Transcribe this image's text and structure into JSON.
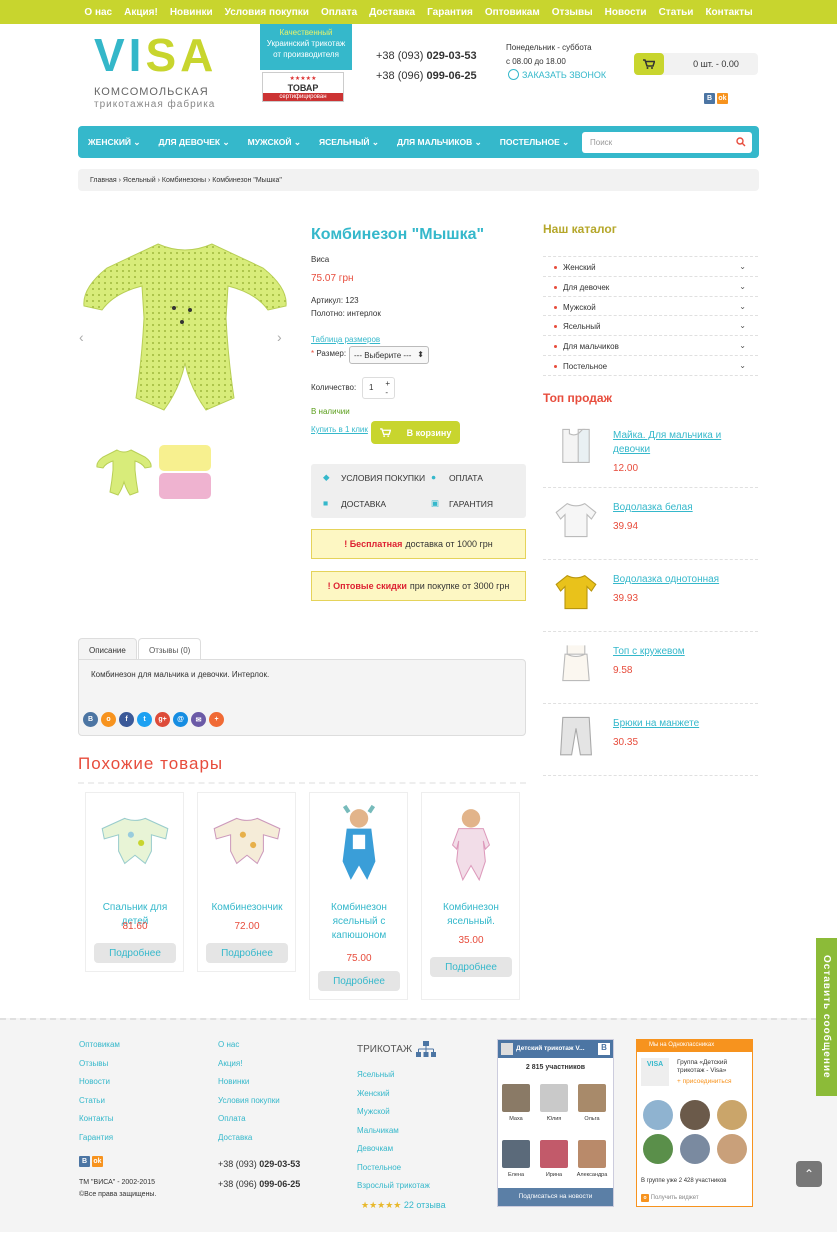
{
  "topnav": [
    "О нас",
    "Акция!",
    "Новинки",
    "Условия покупки",
    "Оплата",
    "Доставка",
    "Гарантия",
    "Оптовикам",
    "Отзывы",
    "Новости",
    "Статьи",
    "Контакты"
  ],
  "logo": {
    "part1": "VI",
    "part2": "SA",
    "sub1": "КОМСОМОЛЬСКАЯ",
    "sub2": "трикотажная фабрика"
  },
  "badge": {
    "line1": "Качественный",
    "line2": "Украинский трикотаж",
    "line3": "от производителя"
  },
  "cert": {
    "title": "ТОВАР",
    "sub": "сертифицирован",
    "stars": "★★★★★"
  },
  "phones": [
    {
      "prefix": "+38 (093) ",
      "number": "029-03-53"
    },
    {
      "prefix": "+38 (096) ",
      "number": "099-06-25"
    }
  ],
  "hours": {
    "days": "Понедельник - суббота",
    "time": "с 08.00 до 18.00"
  },
  "callback": "ЗАКАЗАТЬ ЗВОНОК",
  "cart": {
    "text": "0 шт. - 0.00"
  },
  "social_small": {
    "vk": "В",
    "ok": "ok"
  },
  "nav": [
    "ЖЕНСКИЙ",
    "ДЛЯ ДЕВОЧЕК",
    "МУЖСКОЙ",
    "ЯСЕЛЬНЫЙ",
    "ДЛЯ МАЛЬЧИКОВ",
    "ПОСТЕЛЬНОЕ"
  ],
  "search": {
    "placeholder": "Поиск"
  },
  "breadcrumb": [
    "Главная",
    "Ясельный",
    "Комбинезоны",
    "Комбинезон \"Мышка\""
  ],
  "product": {
    "title": "Комбинезон \"Мышка\"",
    "brand": "Виса",
    "price": "75.07 грн",
    "sku_label": "Артикул:",
    "sku": "123",
    "fabric_label": "Полотно:",
    "fabric": "интерлок",
    "size_table": "Таблица размеров",
    "size_label": "Размер:",
    "size_value": "--- Выберите ---",
    "qty_label": "Количество:",
    "qty": "1",
    "stock": "В наличии",
    "one_click": "Купить в 1 клик",
    "add_to_cart": "В корзину"
  },
  "info_links": [
    "УСЛОВИЯ ПОКУПКИ",
    "ОПЛАТА",
    "ДОСТАВКА",
    "ГАРАНТИЯ"
  ],
  "promos": [
    {
      "bold": "! Бесплатная",
      "text": "доставка от 1000 грн"
    },
    {
      "bold": "! Оптовые скидки",
      "text": "при покупке от 3000 грн"
    }
  ],
  "tabs": [
    "Описание",
    "Отзывы (0)"
  ],
  "description": "Комбинезон для мальчика и девочки. Интерлок.",
  "share_icons": [
    "В",
    "о",
    "f",
    "t",
    "g+",
    "@",
    "✉",
    "+"
  ],
  "sidebar": {
    "catalog_title": "Наш каталог",
    "catalog": [
      "Женский",
      "Для девочек",
      "Мужской",
      "Ясельный",
      "Для мальчиков",
      "Постельное"
    ],
    "top_title": "Топ продаж",
    "top": [
      {
        "name": "Майка. Для мальчика и девочки",
        "price": "12.00"
      },
      {
        "name": "Водолазка белая",
        "price": "39.94"
      },
      {
        "name": "Водолазка однотонная",
        "price": "39.93"
      },
      {
        "name": "Топ с кружевом",
        "price": "9.58"
      },
      {
        "name": "Брюки на манжете",
        "price": "30.35"
      }
    ]
  },
  "similar": {
    "title": "Похожие товары",
    "button": "Подробнее",
    "items": [
      {
        "name": "Спальник для детей",
        "price": "81.60"
      },
      {
        "name": "Комбинезончик",
        "price": "72.00"
      },
      {
        "name": "Комбинезон ясельный с капюшоном",
        "price": "75.00"
      },
      {
        "name": "Комбинезон ясельный.",
        "price": "35.00"
      }
    ]
  },
  "footer": {
    "col1": [
      "Оптовикам",
      "Отзывы",
      "Новости",
      "Статьи",
      "Контакты",
      "Гарантия"
    ],
    "col2": [
      "О нас",
      "Акция!",
      "Новинки",
      "Условия покупки",
      "Оплата",
      "Доставка"
    ],
    "copyright1": "ТМ \"ВИСА\" - 2002-2015",
    "copyright2": "©Все права защищены.",
    "knit_title": "ТРИКОТАЖ",
    "knit": [
      "Ясельный",
      "Женский",
      "Мужской",
      "Мальчикам",
      "Девочкам",
      "Постельное",
      "Взрослый трикотаж"
    ],
    "stars": "★★★★★",
    "reviews": "22 отзыва",
    "vk": {
      "title": "Детский трикотаж V...",
      "members": "2 815 участников",
      "names": [
        "Маха",
        "Юлия",
        "Ольга",
        "Елена",
        "Ирина",
        "Александра"
      ],
      "subscribe": "Подписаться на новости"
    },
    "ok": {
      "header": "Мы на Одноклассниках",
      "group": "Группа «Детский трикотаж - Visa»",
      "join": "присоединиться",
      "count": "В группе уже 2 428 участников",
      "widget": "Получить виджет"
    }
  },
  "feedback": "Оставить сообщение",
  "up": "⌃"
}
